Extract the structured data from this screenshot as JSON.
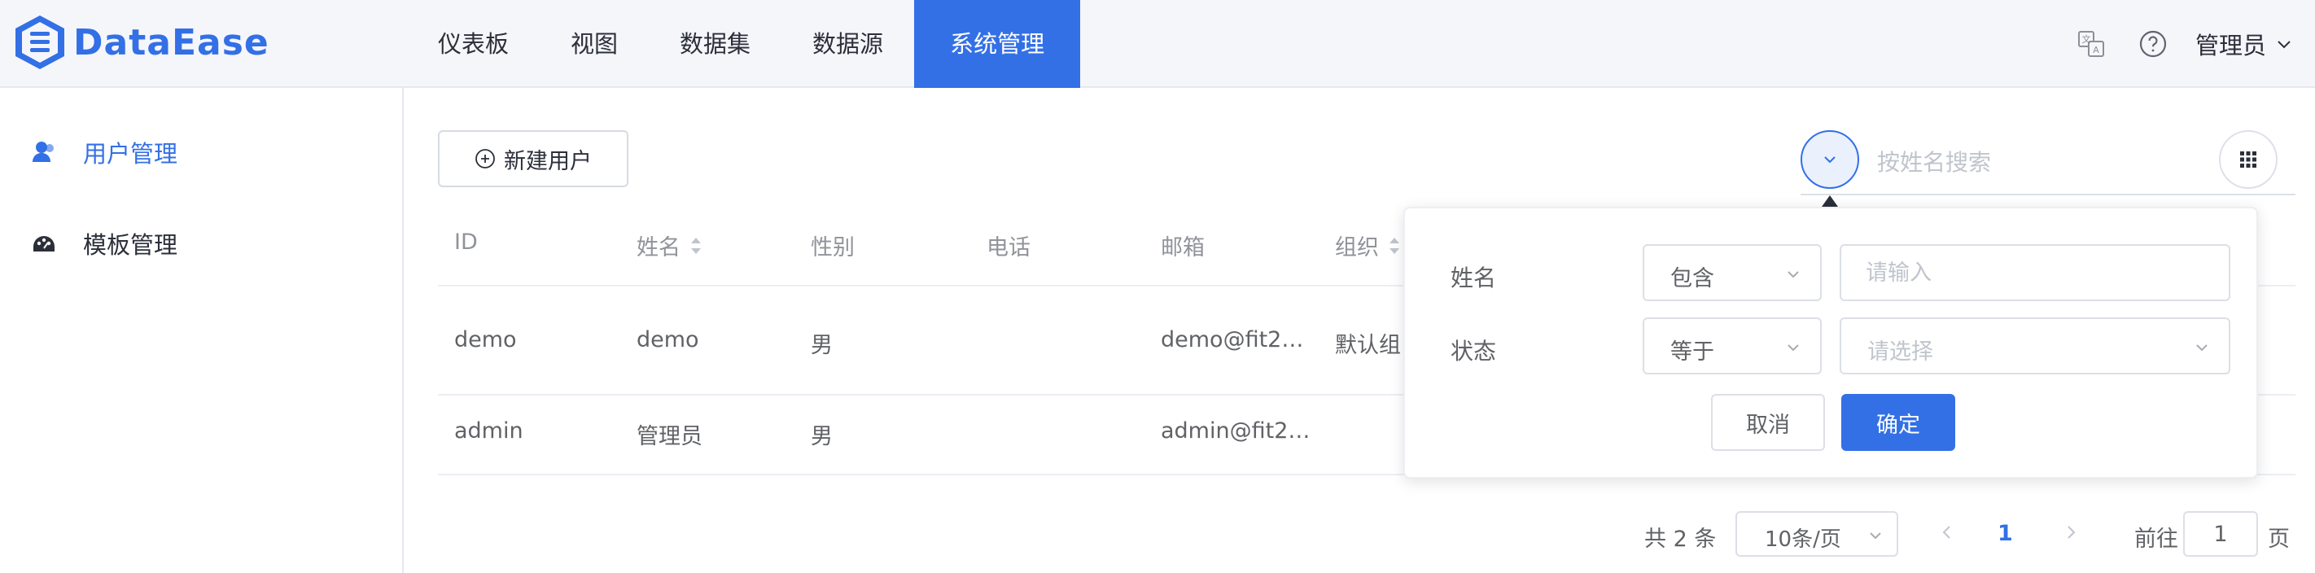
{
  "app": {
    "logo_text": "DataEase"
  },
  "nav": {
    "items": [
      {
        "label": "仪表板"
      },
      {
        "label": "视图"
      },
      {
        "label": "数据集"
      },
      {
        "label": "数据源"
      },
      {
        "label": "系统管理",
        "active": true
      }
    ]
  },
  "header": {
    "user_label": "管理员",
    "icons": [
      "language-icon",
      "help-icon",
      "chevron-down-icon"
    ]
  },
  "sidebar": {
    "items": [
      {
        "label": "用户管理",
        "icon": "user-icon",
        "active": true
      },
      {
        "label": "模板管理",
        "icon": "template-icon",
        "active": false
      }
    ]
  },
  "toolbar": {
    "new_user_label": "新建用户",
    "search_placeholder": "按姓名搜索"
  },
  "table": {
    "columns": [
      "ID",
      "姓名",
      "性别",
      "电话",
      "邮箱",
      "组织"
    ],
    "rows": [
      {
        "id": "demo",
        "name": "demo",
        "gender": "男",
        "phone": "",
        "email": "demo@fit2…",
        "org": "默认组"
      },
      {
        "id": "admin",
        "name": "管理员",
        "gender": "男",
        "phone": "",
        "email": "admin@fit2…",
        "org": ""
      }
    ]
  },
  "filter": {
    "name_label": "姓名",
    "name_operator": "包含",
    "name_placeholder": "请输入",
    "status_label": "状态",
    "status_operator": "等于",
    "status_placeholder": "请选择",
    "cancel_label": "取消",
    "confirm_label": "确定"
  },
  "pagination": {
    "total_text": "共 2 条",
    "page_size": "10条/页",
    "current_page": "1",
    "goto_label": "前往",
    "goto_value": "1",
    "page_suffix": "页"
  },
  "colors": {
    "accent": "#3370e6",
    "header_bg": "#f5f6fa",
    "text": "#2b2f3a",
    "muted": "#909399"
  }
}
